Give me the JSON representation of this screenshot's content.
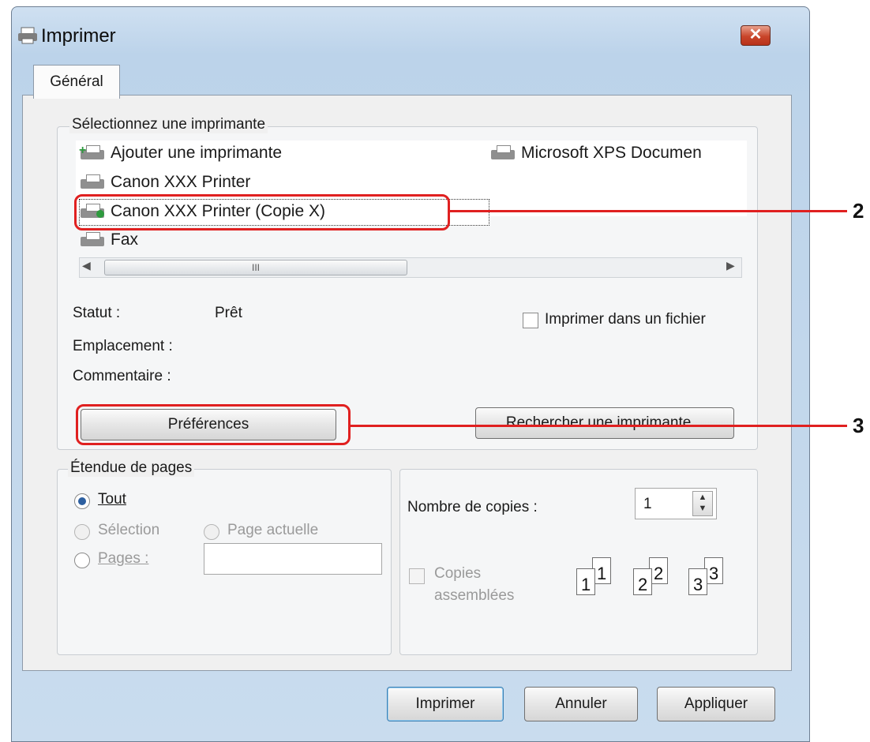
{
  "window": {
    "title": "Imprimer",
    "close_glyph": "✕"
  },
  "tabs": [
    {
      "label": "Général"
    }
  ],
  "select_printer": {
    "legend": "Sélectionnez une imprimante",
    "printers": [
      {
        "label": "Ajouter une imprimante",
        "icon": "add-printer-icon"
      },
      {
        "label": "Microsoft XPS Documen",
        "icon": "printer-icon"
      },
      {
        "label": "Canon XXX Printer",
        "icon": "printer-icon"
      },
      {
        "label": "Canon XXX Printer (Copie X)",
        "icon": "printer-default-icon",
        "selected": true
      },
      {
        "label": "Fax",
        "icon": "fax-icon"
      }
    ],
    "scroll_thumb_glyph": "III",
    "status_label": "Statut :",
    "status_value": "Prêt",
    "location_label": "Emplacement :",
    "comment_label": "Commentaire :",
    "print_to_file_label": "Imprimer dans un fichier",
    "preferences_button": "Préférences",
    "find_printer_button": "Rechercher une imprimante..."
  },
  "page_range": {
    "legend": "Étendue de pages",
    "all_label": "Tout",
    "selection_label": "Sélection",
    "current_page_label": "Page actuelle",
    "pages_label": "Pages :",
    "pages_value": ""
  },
  "copies": {
    "number_label": "Nombre de copies :",
    "number_value": "1",
    "collate_label_line1": "Copies",
    "collate_label_line2": "assemblées",
    "collate_icon": [
      "1",
      "1",
      "2",
      "2",
      "3",
      "3"
    ]
  },
  "footer": {
    "print_button": "Imprimer",
    "cancel_button": "Annuler",
    "apply_button": "Appliquer"
  },
  "callouts": [
    "2",
    "3"
  ],
  "colors": {
    "callout": "#e02020",
    "title_bar": "#c9dcee",
    "close": "#c9452a"
  }
}
